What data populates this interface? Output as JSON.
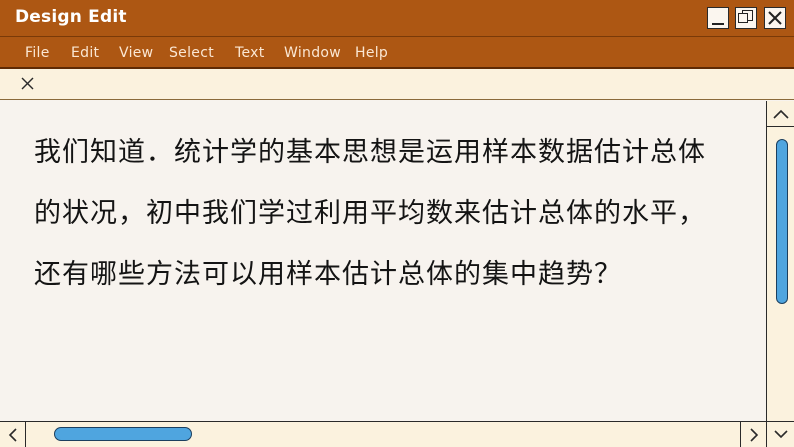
{
  "window": {
    "title": "Design Edit"
  },
  "menu": {
    "items": [
      "File",
      "Edit",
      "View",
      "Select",
      "Text",
      "Window",
      "Help"
    ]
  },
  "content": {
    "lines": [
      "我们知道．统计学的基本思想是运用样本数据估计总体",
      "的状况，初中我们学过利用平均数来估计总体的水平，",
      "还有哪些方法可以用样本估计总体的集中趋势？"
    ]
  },
  "colors": {
    "titlebar": "#ad5713",
    "menubar": "#ad5713",
    "tabrow": "#fbf2de",
    "content_bg": "#f7f3ee",
    "scroll_thumb": "#4fa5df"
  },
  "icons": {
    "minimize": "minimize-icon",
    "maximize": "maximize-icon",
    "close": "close-icon",
    "tab_close": "close-icon",
    "scroll_up": "chevron-up-icon",
    "scroll_left": "chevron-left-icon",
    "scroll_right": "chevron-right-icon",
    "scroll_down": "chevron-down-icon"
  }
}
